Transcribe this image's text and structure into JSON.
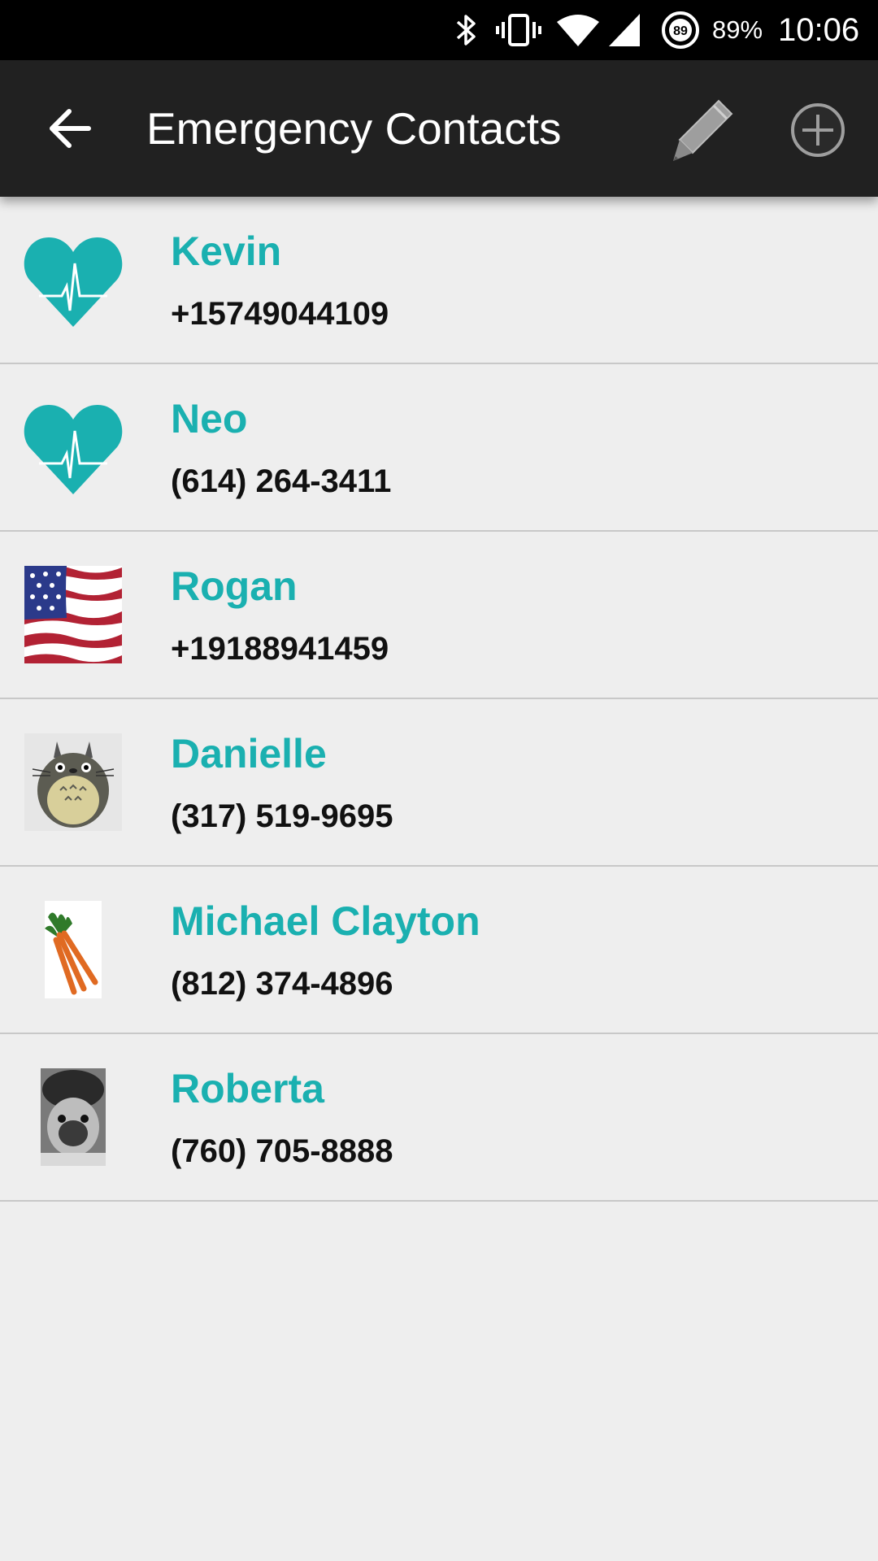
{
  "status_bar": {
    "battery_text": "89%",
    "battery_ring_value": "89",
    "time": "10:06",
    "icons": [
      "bluetooth-icon",
      "vibrate-icon",
      "wifi-icon",
      "cell-signal-icon",
      "battery-saver-icon"
    ]
  },
  "app_bar": {
    "title": "Emergency Contacts",
    "back_icon": "arrow-back-icon",
    "edit_icon": "pencil-icon",
    "add_icon": "add-circle-icon",
    "background": "#212121"
  },
  "accent_color": "#1ab0b0",
  "contacts": [
    {
      "name": "Kevin",
      "phone": "+15749044109",
      "avatar": "heart-pulse-icon"
    },
    {
      "name": "Neo",
      "phone": "(614) 264-3411",
      "avatar": "heart-pulse-icon"
    },
    {
      "name": "Rogan",
      "phone": "+19188941459",
      "avatar": "us-flag-photo"
    },
    {
      "name": "Danielle",
      "phone": "(317) 519-9695",
      "avatar": "totoro-photo"
    },
    {
      "name": "Michael Clayton",
      "phone": "(812) 374-4896",
      "avatar": "carrots-photo"
    },
    {
      "name": "Roberta",
      "phone": "(760) 705-8888",
      "avatar": "pug-photo"
    }
  ]
}
